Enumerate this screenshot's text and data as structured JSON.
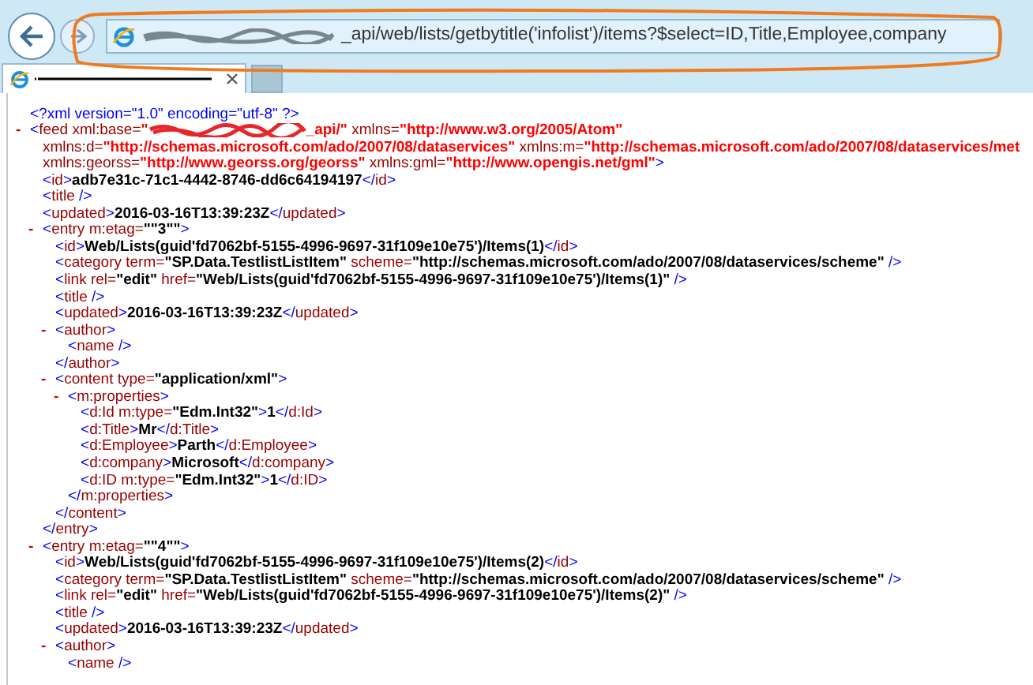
{
  "address_bar": {
    "url": "_api/web/lists/getbytitle('infolist')/items?$select=ID,Title,Employee,company"
  },
  "tab": {
    "selected": true
  },
  "document": {
    "prolog": [
      {
        "kind": "punct",
        "text": "<?xml version=\"1.0\" encoding=\"utf-8\" ?>"
      }
    ],
    "nodes": [
      {
        "toggle": "-",
        "expanded": true,
        "open": [
          [
            {
              "kind": "punct",
              "text": "<"
            },
            {
              "kind": "name",
              "text": "feed"
            },
            {
              "kind": "attr",
              "text": " xml:base="
            },
            {
              "kind": "ns",
              "text": "\""
            },
            {
              "kind": "redact"
            },
            {
              "kind": "ns",
              "text": "_api/\""
            },
            {
              "kind": "attr",
              "text": " xmlns="
            },
            {
              "kind": "ns",
              "text": "\"http://www.w3.org/2005/Atom\""
            }
          ],
          [
            {
              "kind": "attr",
              "text": "xmlns:d="
            },
            {
              "kind": "ns",
              "text": "\"http://schemas.microsoft.com/ado/2007/08/dataservices\""
            },
            {
              "kind": "attr",
              "text": " xmlns:m="
            },
            {
              "kind": "ns",
              "text": "\"http://schemas.microsoft.com/ado/2007/08/dataservices/met"
            }
          ],
          [
            {
              "kind": "attr",
              "text": "xmlns:georss="
            },
            {
              "kind": "ns",
              "text": "\"http://www.georss.org/georss\""
            },
            {
              "kind": "attr",
              "text": " xmlns:gml="
            },
            {
              "kind": "ns",
              "text": "\"http://www.opengis.net/gml\""
            },
            {
              "kind": "punct",
              "text": ">"
            }
          ]
        ],
        "children": [
          {
            "open": [
              [
                {
                  "kind": "punct",
                  "text": "<"
                },
                {
                  "kind": "name",
                  "text": "id"
                },
                {
                  "kind": "punct",
                  "text": ">"
                },
                {
                  "kind": "text",
                  "text": "adb7e31c-71c1-4442-8746-dd6c64194197"
                },
                {
                  "kind": "punct",
                  "text": "</"
                },
                {
                  "kind": "name",
                  "text": "id"
                },
                {
                  "kind": "punct",
                  "text": ">"
                }
              ]
            ]
          },
          {
            "open": [
              [
                {
                  "kind": "punct",
                  "text": "<"
                },
                {
                  "kind": "name",
                  "text": "title"
                },
                {
                  "kind": "punct",
                  "text": " />"
                }
              ]
            ]
          },
          {
            "open": [
              [
                {
                  "kind": "punct",
                  "text": "<"
                },
                {
                  "kind": "name",
                  "text": "updated"
                },
                {
                  "kind": "punct",
                  "text": ">"
                },
                {
                  "kind": "text",
                  "text": "2016-03-16T13:39:23Z"
                },
                {
                  "kind": "punct",
                  "text": "</"
                },
                {
                  "kind": "name",
                  "text": "updated"
                },
                {
                  "kind": "punct",
                  "text": ">"
                }
              ]
            ]
          },
          {
            "toggle": "-",
            "expanded": true,
            "open": [
              [
                {
                  "kind": "punct",
                  "text": "<"
                },
                {
                  "kind": "name",
                  "text": "entry"
                },
                {
                  "kind": "attr",
                  "text": " m:etag="
                },
                {
                  "kind": "value",
                  "text": "\"\"3\"\""
                },
                {
                  "kind": "punct",
                  "text": ">"
                }
              ]
            ],
            "children": [
              {
                "open": [
                  [
                    {
                      "kind": "punct",
                      "text": "<"
                    },
                    {
                      "kind": "name",
                      "text": "id"
                    },
                    {
                      "kind": "punct",
                      "text": ">"
                    },
                    {
                      "kind": "text",
                      "text": "Web/Lists(guid'fd7062bf-5155-4996-9697-31f109e10e75')/Items(1)"
                    },
                    {
                      "kind": "punct",
                      "text": "</"
                    },
                    {
                      "kind": "name",
                      "text": "id"
                    },
                    {
                      "kind": "punct",
                      "text": ">"
                    }
                  ]
                ]
              },
              {
                "open": [
                  [
                    {
                      "kind": "punct",
                      "text": "<"
                    },
                    {
                      "kind": "name",
                      "text": "category"
                    },
                    {
                      "kind": "attr",
                      "text": " term="
                    },
                    {
                      "kind": "value",
                      "text": "\"SP.Data.TestlistListItem\""
                    },
                    {
                      "kind": "attr",
                      "text": " scheme="
                    },
                    {
                      "kind": "value",
                      "text": "\"http://schemas.microsoft.com/ado/2007/08/dataservices/scheme\""
                    },
                    {
                      "kind": "punct",
                      "text": " />"
                    }
                  ]
                ]
              },
              {
                "open": [
                  [
                    {
                      "kind": "punct",
                      "text": "<"
                    },
                    {
                      "kind": "name",
                      "text": "link"
                    },
                    {
                      "kind": "attr",
                      "text": " rel="
                    },
                    {
                      "kind": "value",
                      "text": "\"edit\""
                    },
                    {
                      "kind": "attr",
                      "text": " href="
                    },
                    {
                      "kind": "value",
                      "text": "\"Web/Lists(guid'fd7062bf-5155-4996-9697-31f109e10e75')/Items(1)\""
                    },
                    {
                      "kind": "punct",
                      "text": " />"
                    }
                  ]
                ]
              },
              {
                "open": [
                  [
                    {
                      "kind": "punct",
                      "text": "<"
                    },
                    {
                      "kind": "name",
                      "text": "title"
                    },
                    {
                      "kind": "punct",
                      "text": " />"
                    }
                  ]
                ]
              },
              {
                "open": [
                  [
                    {
                      "kind": "punct",
                      "text": "<"
                    },
                    {
                      "kind": "name",
                      "text": "updated"
                    },
                    {
                      "kind": "punct",
                      "text": ">"
                    },
                    {
                      "kind": "text",
                      "text": "2016-03-16T13:39:23Z"
                    },
                    {
                      "kind": "punct",
                      "text": "</"
                    },
                    {
                      "kind": "name",
                      "text": "updated"
                    },
                    {
                      "kind": "punct",
                      "text": ">"
                    }
                  ]
                ]
              },
              {
                "toggle": "-",
                "expanded": true,
                "open": [
                  [
                    {
                      "kind": "punct",
                      "text": "<"
                    },
                    {
                      "kind": "name",
                      "text": "author"
                    },
                    {
                      "kind": "punct",
                      "text": ">"
                    }
                  ]
                ],
                "children": [
                  {
                    "open": [
                      [
                        {
                          "kind": "punct",
                          "text": "<"
                        },
                        {
                          "kind": "name",
                          "text": "name"
                        },
                        {
                          "kind": "punct",
                          "text": " />"
                        }
                      ]
                    ]
                  }
                ],
                "close": [
                  {
                    "kind": "punct",
                    "text": "</"
                  },
                  {
                    "kind": "name",
                    "text": "author"
                  },
                  {
                    "kind": "punct",
                    "text": ">"
                  }
                ]
              },
              {
                "toggle": "-",
                "expanded": true,
                "open": [
                  [
                    {
                      "kind": "punct",
                      "text": "<"
                    },
                    {
                      "kind": "name",
                      "text": "content"
                    },
                    {
                      "kind": "attr",
                      "text": " type="
                    },
                    {
                      "kind": "value",
                      "text": "\"application/xml\""
                    },
                    {
                      "kind": "punct",
                      "text": ">"
                    }
                  ]
                ],
                "children": [
                  {
                    "toggle": "-",
                    "expanded": true,
                    "open": [
                      [
                        {
                          "kind": "punct",
                          "text": "<"
                        },
                        {
                          "kind": "name",
                          "text": "m:properties"
                        },
                        {
                          "kind": "punct",
                          "text": ">"
                        }
                      ]
                    ],
                    "children": [
                      {
                        "open": [
                          [
                            {
                              "kind": "punct",
                              "text": "<"
                            },
                            {
                              "kind": "name",
                              "text": "d:Id"
                            },
                            {
                              "kind": "attr",
                              "text": " m:type="
                            },
                            {
                              "kind": "value",
                              "text": "\"Edm.Int32\""
                            },
                            {
                              "kind": "punct",
                              "text": ">"
                            },
                            {
                              "kind": "text",
                              "text": "1"
                            },
                            {
                              "kind": "punct",
                              "text": "</"
                            },
                            {
                              "kind": "name",
                              "text": "d:Id"
                            },
                            {
                              "kind": "punct",
                              "text": ">"
                            }
                          ]
                        ]
                      },
                      {
                        "open": [
                          [
                            {
                              "kind": "punct",
                              "text": "<"
                            },
                            {
                              "kind": "name",
                              "text": "d:Title"
                            },
                            {
                              "kind": "punct",
                              "text": ">"
                            },
                            {
                              "kind": "text",
                              "text": "Mr"
                            },
                            {
                              "kind": "punct",
                              "text": "</"
                            },
                            {
                              "kind": "name",
                              "text": "d:Title"
                            },
                            {
                              "kind": "punct",
                              "text": ">"
                            }
                          ]
                        ]
                      },
                      {
                        "open": [
                          [
                            {
                              "kind": "punct",
                              "text": "<"
                            },
                            {
                              "kind": "name",
                              "text": "d:Employee"
                            },
                            {
                              "kind": "punct",
                              "text": ">"
                            },
                            {
                              "kind": "text",
                              "text": "Parth"
                            },
                            {
                              "kind": "punct",
                              "text": "</"
                            },
                            {
                              "kind": "name",
                              "text": "d:Employee"
                            },
                            {
                              "kind": "punct",
                              "text": ">"
                            }
                          ]
                        ]
                      },
                      {
                        "open": [
                          [
                            {
                              "kind": "punct",
                              "text": "<"
                            },
                            {
                              "kind": "name",
                              "text": "d:company"
                            },
                            {
                              "kind": "punct",
                              "text": ">"
                            },
                            {
                              "kind": "text",
                              "text": "Microsoft"
                            },
                            {
                              "kind": "punct",
                              "text": "</"
                            },
                            {
                              "kind": "name",
                              "text": "d:company"
                            },
                            {
                              "kind": "punct",
                              "text": ">"
                            }
                          ]
                        ]
                      },
                      {
                        "open": [
                          [
                            {
                              "kind": "punct",
                              "text": "<"
                            },
                            {
                              "kind": "name",
                              "text": "d:ID"
                            },
                            {
                              "kind": "attr",
                              "text": " m:type="
                            },
                            {
                              "kind": "value",
                              "text": "\"Edm.Int32\""
                            },
                            {
                              "kind": "punct",
                              "text": ">"
                            },
                            {
                              "kind": "text",
                              "text": "1"
                            },
                            {
                              "kind": "punct",
                              "text": "</"
                            },
                            {
                              "kind": "name",
                              "text": "d:ID"
                            },
                            {
                              "kind": "punct",
                              "text": ">"
                            }
                          ]
                        ]
                      }
                    ],
                    "close": [
                      {
                        "kind": "punct",
                        "text": "</"
                      },
                      {
                        "kind": "name",
                        "text": "m:properties"
                      },
                      {
                        "kind": "punct",
                        "text": ">"
                      }
                    ]
                  }
                ],
                "close": [
                  {
                    "kind": "punct",
                    "text": "</"
                  },
                  {
                    "kind": "name",
                    "text": "content"
                  },
                  {
                    "kind": "punct",
                    "text": ">"
                  }
                ]
              }
            ],
            "close": [
              {
                "kind": "punct",
                "text": "</"
              },
              {
                "kind": "name",
                "text": "entry"
              },
              {
                "kind": "punct",
                "text": ">"
              }
            ]
          },
          {
            "toggle": "-",
            "expanded": true,
            "open": [
              [
                {
                  "kind": "punct",
                  "text": "<"
                },
                {
                  "kind": "name",
                  "text": "entry"
                },
                {
                  "kind": "attr",
                  "text": " m:etag="
                },
                {
                  "kind": "value",
                  "text": "\"\"4\"\""
                },
                {
                  "kind": "punct",
                  "text": ">"
                }
              ]
            ],
            "children": [
              {
                "open": [
                  [
                    {
                      "kind": "punct",
                      "text": "<"
                    },
                    {
                      "kind": "name",
                      "text": "id"
                    },
                    {
                      "kind": "punct",
                      "text": ">"
                    },
                    {
                      "kind": "text",
                      "text": "Web/Lists(guid'fd7062bf-5155-4996-9697-31f109e10e75')/Items(2)"
                    },
                    {
                      "kind": "punct",
                      "text": "</"
                    },
                    {
                      "kind": "name",
                      "text": "id"
                    },
                    {
                      "kind": "punct",
                      "text": ">"
                    }
                  ]
                ]
              },
              {
                "open": [
                  [
                    {
                      "kind": "punct",
                      "text": "<"
                    },
                    {
                      "kind": "name",
                      "text": "category"
                    },
                    {
                      "kind": "attr",
                      "text": " term="
                    },
                    {
                      "kind": "value",
                      "text": "\"SP.Data.TestlistListItem\""
                    },
                    {
                      "kind": "attr",
                      "text": " scheme="
                    },
                    {
                      "kind": "value",
                      "text": "\"http://schemas.microsoft.com/ado/2007/08/dataservices/scheme\""
                    },
                    {
                      "kind": "punct",
                      "text": " />"
                    }
                  ]
                ]
              },
              {
                "open": [
                  [
                    {
                      "kind": "punct",
                      "text": "<"
                    },
                    {
                      "kind": "name",
                      "text": "link"
                    },
                    {
                      "kind": "attr",
                      "text": " rel="
                    },
                    {
                      "kind": "value",
                      "text": "\"edit\""
                    },
                    {
                      "kind": "attr",
                      "text": " href="
                    },
                    {
                      "kind": "value",
                      "text": "\"Web/Lists(guid'fd7062bf-5155-4996-9697-31f109e10e75')/Items(2)\""
                    },
                    {
                      "kind": "punct",
                      "text": " />"
                    }
                  ]
                ]
              },
              {
                "open": [
                  [
                    {
                      "kind": "punct",
                      "text": "<"
                    },
                    {
                      "kind": "name",
                      "text": "title"
                    },
                    {
                      "kind": "punct",
                      "text": " />"
                    }
                  ]
                ]
              },
              {
                "open": [
                  [
                    {
                      "kind": "punct",
                      "text": "<"
                    },
                    {
                      "kind": "name",
                      "text": "updated"
                    },
                    {
                      "kind": "punct",
                      "text": ">"
                    },
                    {
                      "kind": "text",
                      "text": "2016-03-16T13:39:23Z"
                    },
                    {
                      "kind": "punct",
                      "text": "</"
                    },
                    {
                      "kind": "name",
                      "text": "updated"
                    },
                    {
                      "kind": "punct",
                      "text": ">"
                    }
                  ]
                ]
              },
              {
                "toggle": "-",
                "expanded": true,
                "open": [
                  [
                    {
                      "kind": "punct",
                      "text": "<"
                    },
                    {
                      "kind": "name",
                      "text": "author"
                    },
                    {
                      "kind": "punct",
                      "text": ">"
                    }
                  ]
                ],
                "children": [
                  {
                    "open": [
                      [
                        {
                          "kind": "punct",
                          "text": "<"
                        },
                        {
                          "kind": "name",
                          "text": "name"
                        },
                        {
                          "kind": "punct",
                          "text": " />"
                        }
                      ]
                    ]
                  }
                ]
              }
            ]
          }
        ]
      }
    ]
  }
}
